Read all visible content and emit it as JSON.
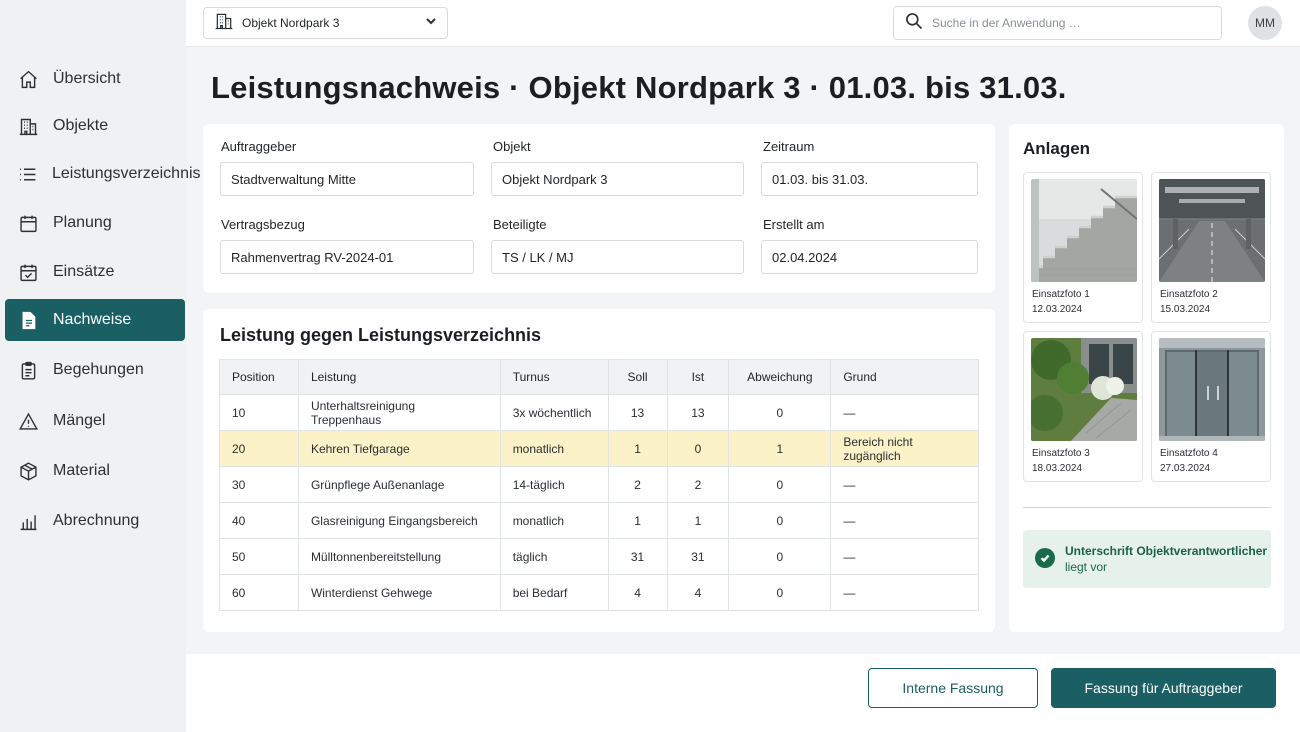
{
  "topbar": {
    "object_select": "Objekt Nordpark 3",
    "search_placeholder": "Suche in der Anwendung …",
    "avatar": "MM"
  },
  "sidebar": {
    "items": [
      {
        "label": "Übersicht",
        "icon": "home-icon",
        "active": false
      },
      {
        "label": "Objekte",
        "icon": "building-icon",
        "active": false
      },
      {
        "label": "Leistungsverzeichnis",
        "icon": "list-icon",
        "active": false
      },
      {
        "label": "Planung",
        "icon": "calendar-icon",
        "active": false
      },
      {
        "label": "Einsätze",
        "icon": "calendar-check-icon",
        "active": false
      },
      {
        "label": "Nachweise",
        "icon": "document-icon",
        "active": true
      },
      {
        "label": "Begehungen",
        "icon": "clipboard-icon",
        "active": false
      },
      {
        "label": "Mängel",
        "icon": "warning-icon",
        "active": false
      },
      {
        "label": "Material",
        "icon": "box-icon",
        "active": false
      },
      {
        "label": "Abrechnung",
        "icon": "bar-chart-icon",
        "active": false
      }
    ]
  },
  "page": {
    "title": "Leistungsnachweis · Objekt Nordpark 3 · 01.03. bis 31.03."
  },
  "meta": {
    "auftraggeber": {
      "label": "Auftraggeber",
      "value": "Stadtverwaltung Mitte"
    },
    "objekt": {
      "label": "Objekt",
      "value": "Objekt Nordpark 3"
    },
    "zeitraum": {
      "label": "Zeitraum",
      "value": "01.03. bis 31.03."
    },
    "vertragsbezug": {
      "label": "Vertragsbezug",
      "value": "Rahmenvertrag RV-2024-01"
    },
    "beteiligte": {
      "label": "Beteiligte",
      "value": "TS / LK / MJ"
    },
    "erstellt": {
      "label": "Erstellt am",
      "value": "02.04.2024"
    }
  },
  "leistungen": {
    "title": "Leistung gegen Leistungsverzeichnis",
    "columns": [
      "Position",
      "Leistung",
      "Turnus",
      "Soll",
      "Ist",
      "Abweichung",
      "Grund"
    ],
    "rows": [
      {
        "position": "10",
        "leistung": "Unterhaltsreinigung Treppenhaus",
        "turnus": "3x wöchentlich",
        "soll": "13",
        "ist": "13",
        "abweichung": "0",
        "grund": "—",
        "highlight": false
      },
      {
        "position": "20",
        "leistung": "Kehren Tiefgarage",
        "turnus": "monatlich",
        "soll": "1",
        "ist": "0",
        "abweichung": "1",
        "grund": "Bereich nicht zugänglich",
        "highlight": true
      },
      {
        "position": "30",
        "leistung": "Grünpflege Außenanlage",
        "turnus": "14-täglich",
        "soll": "2",
        "ist": "2",
        "abweichung": "0",
        "grund": "—",
        "highlight": false
      },
      {
        "position": "40",
        "leistung": "Glasreinigung Eingangsbereich",
        "turnus": "monatlich",
        "soll": "1",
        "ist": "1",
        "abweichung": "0",
        "grund": "—",
        "highlight": false
      },
      {
        "position": "50",
        "leistung": "Mülltonnenbereitstellung",
        "turnus": "täglich",
        "soll": "31",
        "ist": "31",
        "abweichung": "0",
        "grund": "—",
        "highlight": false
      },
      {
        "position": "60",
        "leistung": "Winterdienst Gehwege",
        "turnus": "bei Bedarf",
        "soll": "4",
        "ist": "4",
        "abweichung": "0",
        "grund": "—",
        "highlight": false
      }
    ]
  },
  "anlagen": {
    "title": "Anlagen",
    "photos": [
      {
        "caption": "Einsatzfoto 1",
        "date": "12.03.2024",
        "scene": "staircase"
      },
      {
        "caption": "Einsatzfoto 2",
        "date": "15.03.2024",
        "scene": "parking-garage"
      },
      {
        "caption": "Einsatzfoto 3",
        "date": "18.03.2024",
        "scene": "garden-path"
      },
      {
        "caption": "Einsatzfoto 4",
        "date": "27.03.2024",
        "scene": "glass-entrance"
      }
    ],
    "signature": {
      "strong": "Unterschrift Objektverantwortlicher",
      "sub": "liegt vor"
    }
  },
  "footer": {
    "internal_button": "Interne Fassung",
    "client_button": "Fassung für Auftraggeber"
  },
  "colors": {
    "accent": "#1a5f63",
    "highlight_row": "#fbf2c8",
    "success": "#1a6b4a"
  }
}
